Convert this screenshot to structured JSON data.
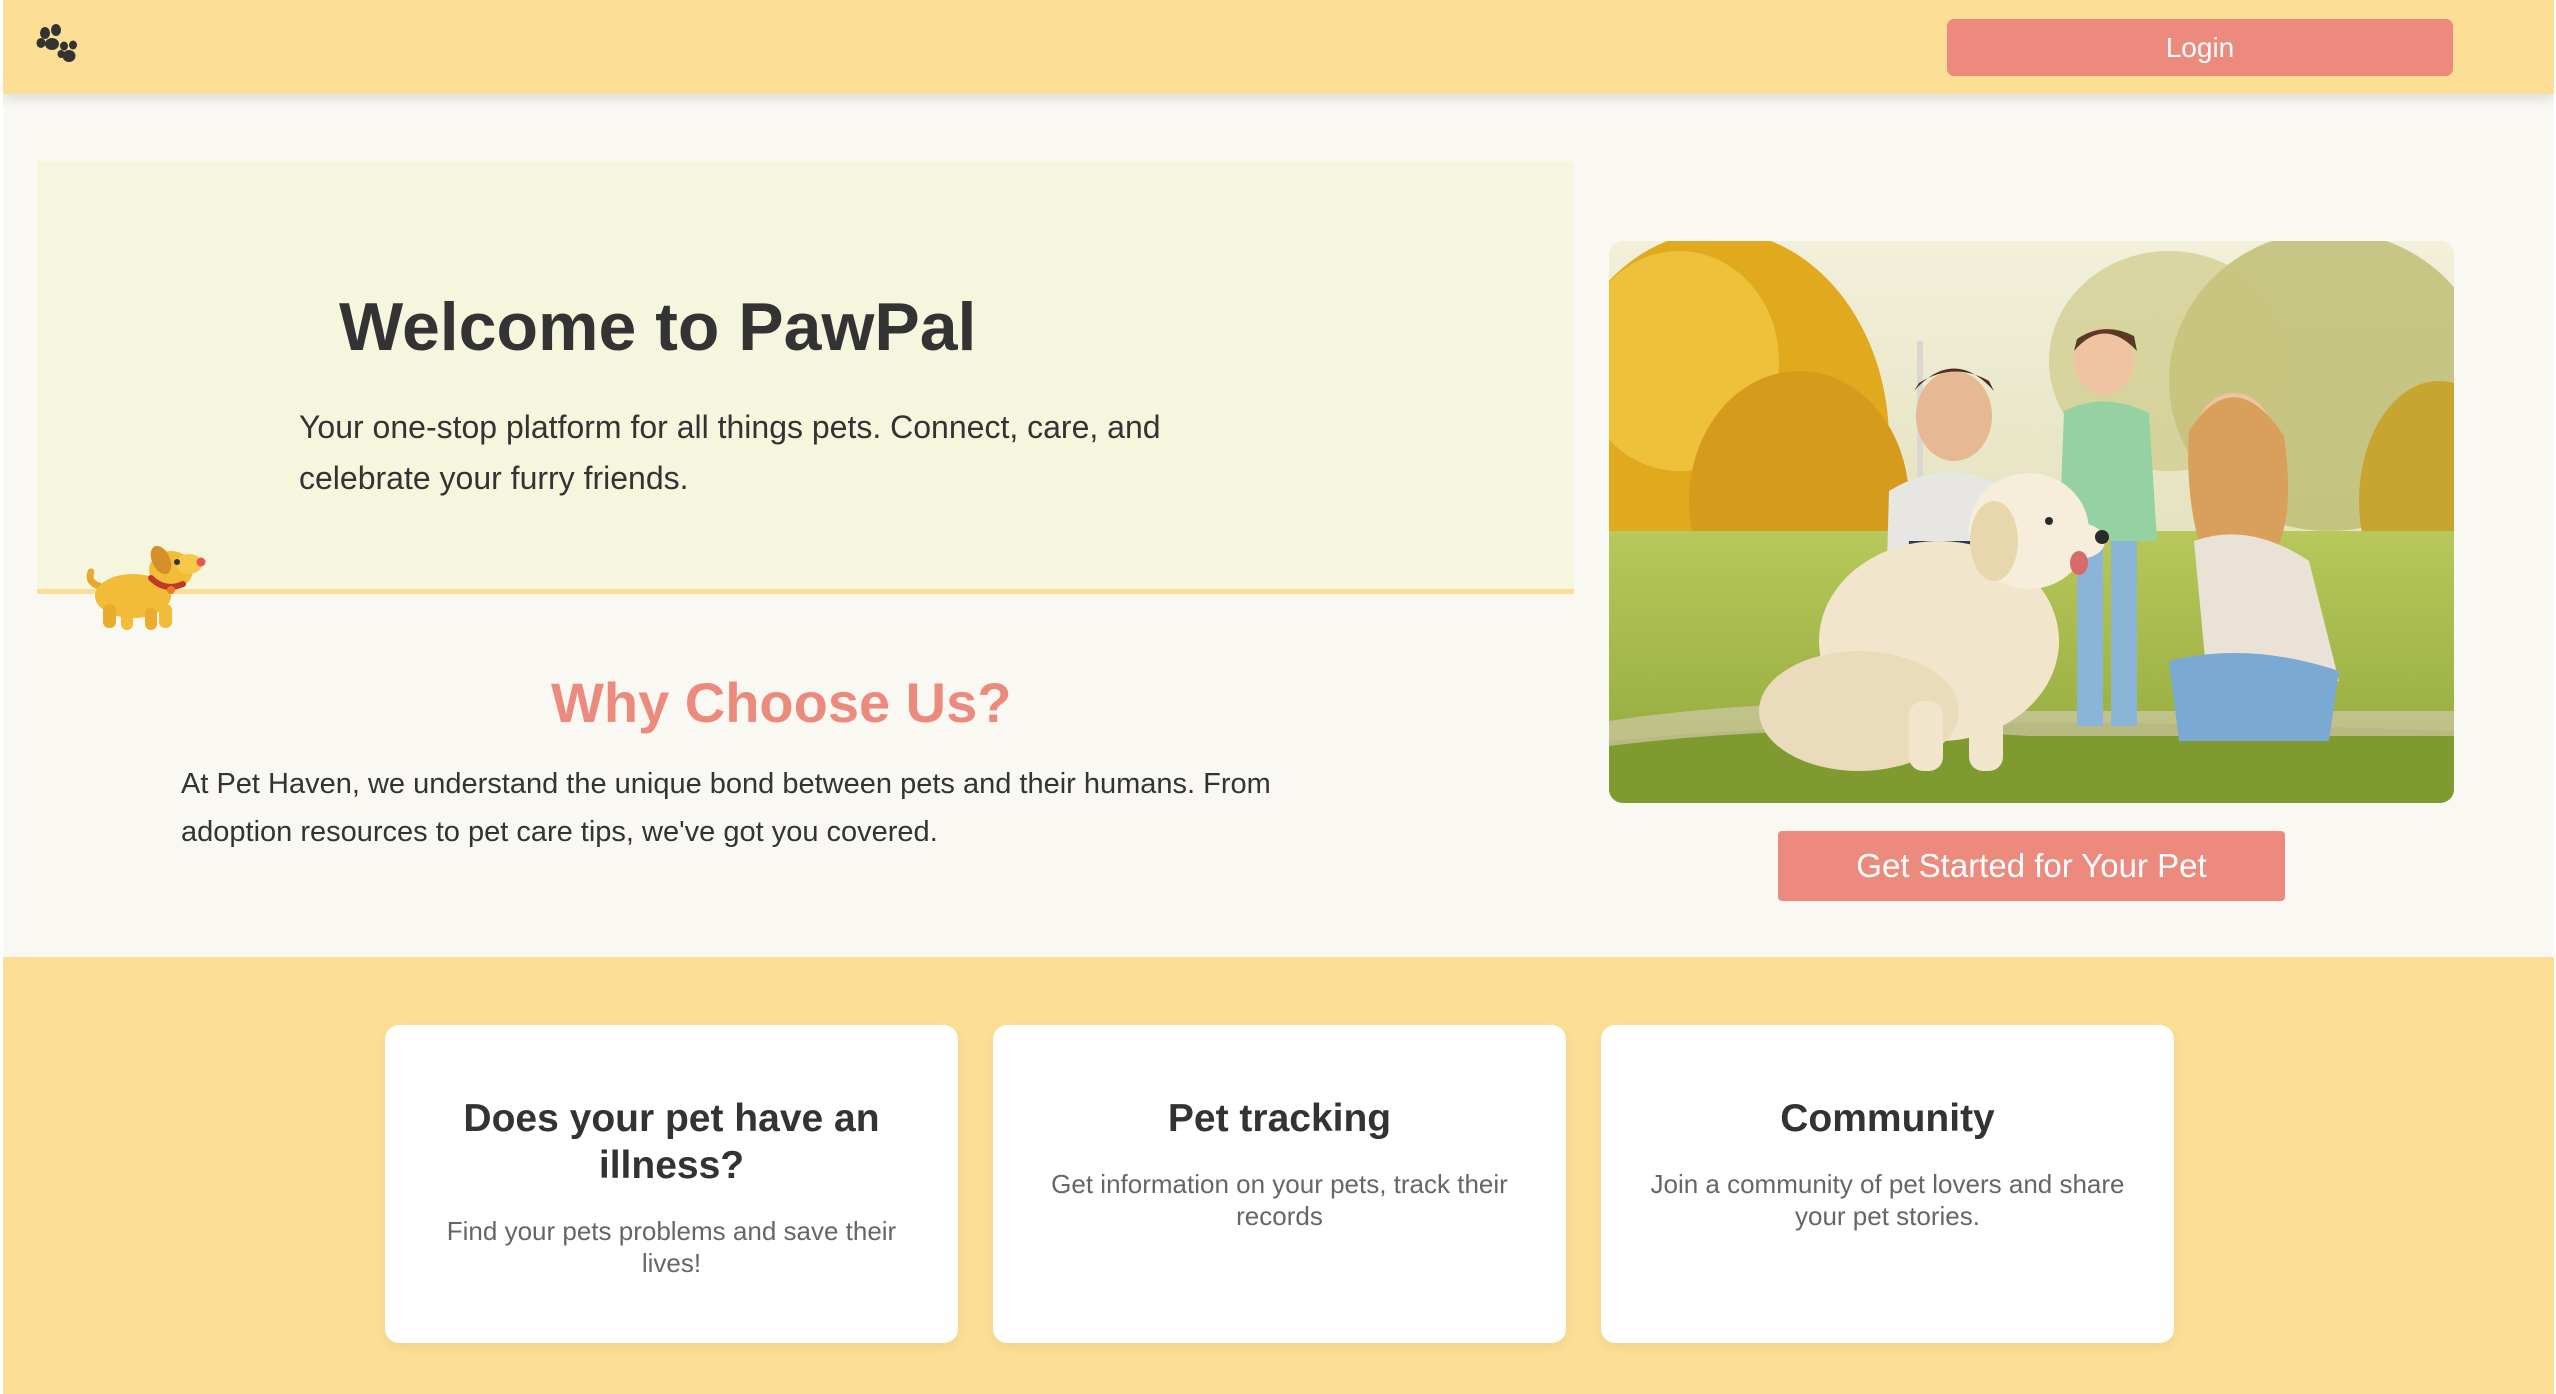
{
  "nav": {
    "logo_icon": "paw-icon",
    "login_label": "Login"
  },
  "hero": {
    "title": "Welcome to PawPal",
    "subtitle": "Your one-stop platform for all things pets. Connect, care, and celebrate your furry friends.",
    "illustration_icon": "dog-illustration-icon"
  },
  "why": {
    "title": "Why Choose Us?",
    "text": "At Pet Haven, we understand the unique bond between pets and their humans. From adoption resources to pet care tips, we've got you covered."
  },
  "cta": {
    "label": "Get Started for Your Pet"
  },
  "features": [
    {
      "title": "Does your pet have an illness?",
      "text": "Find your pets problems and save their lives!"
    },
    {
      "title": "Pet tracking",
      "text": "Get information on your pets, track their records"
    },
    {
      "title": "Community",
      "text": "Join a community of pet lovers and share your pet stories."
    }
  ],
  "colors": {
    "nav_background": "#fcdf94",
    "accent": "#ec8a7e",
    "hero_panel": "#f6f5dd",
    "page_background": "#faf8f3",
    "text": "#333333"
  }
}
